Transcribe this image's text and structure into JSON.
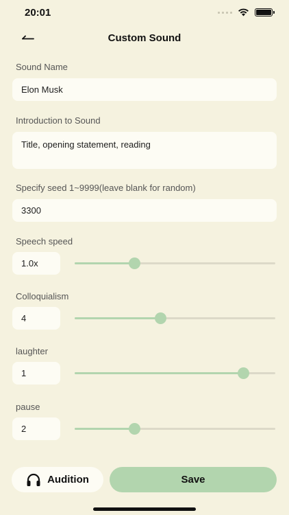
{
  "status_bar": {
    "time": "20:01"
  },
  "nav": {
    "title": "Custom Sound"
  },
  "form": {
    "sound_name": {
      "label": "Sound Name",
      "value": "Elon Musk"
    },
    "introduction": {
      "label": "Introduction to Sound",
      "value": "Title, opening statement, reading"
    },
    "seed": {
      "label": "Specify seed 1~9999(leave blank for random)",
      "value": "3300"
    },
    "sliders": [
      {
        "label": "Speech speed",
        "value": "1.0x",
        "fraction": 0.3
      },
      {
        "label": "Colloquialism",
        "value": "4",
        "fraction": 0.43
      },
      {
        "label": "laughter",
        "value": "1",
        "fraction": 0.84
      },
      {
        "label": "pause",
        "value": "2",
        "fraction": 0.3
      }
    ]
  },
  "actions": {
    "audition_label": "Audition",
    "save_label": "Save"
  },
  "colors": {
    "background": "#f5f2df",
    "accent": "#b2d5ae",
    "field": "#fdfcf4"
  }
}
